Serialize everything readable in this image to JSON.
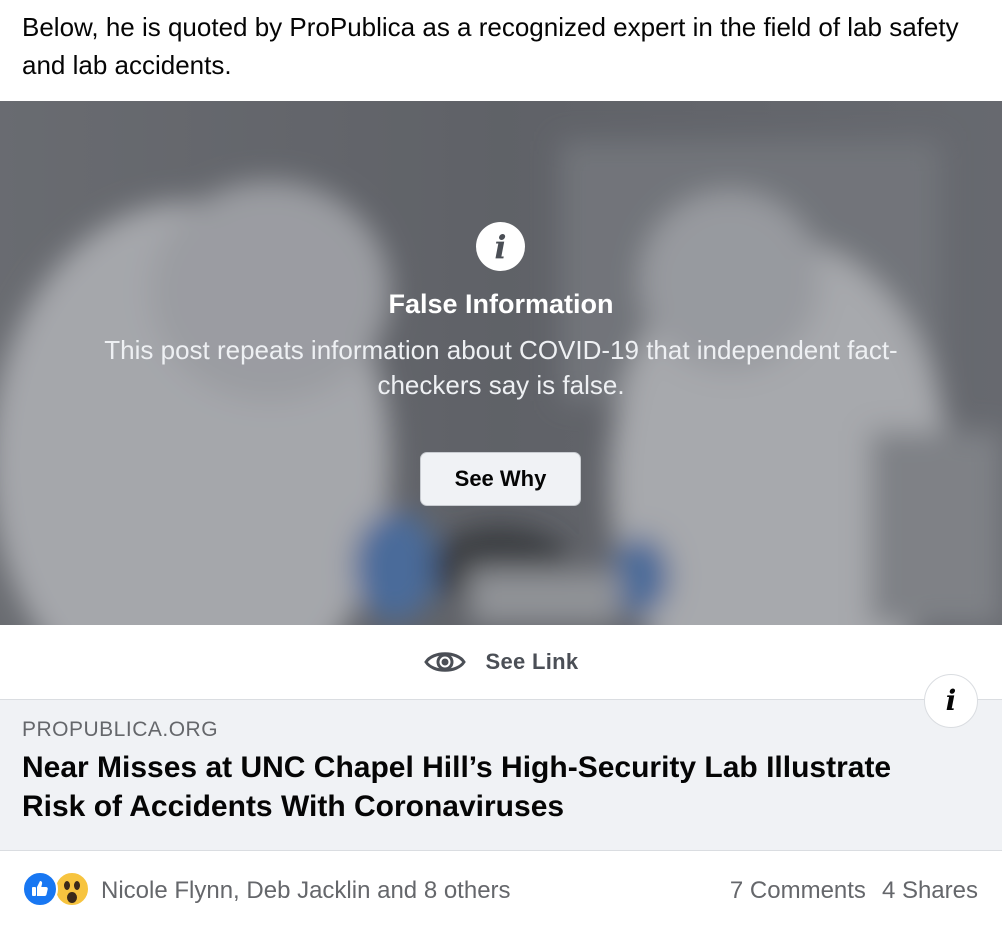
{
  "post": {
    "text": "Below, he is quoted by ProPublica as a recognized expert in the field of lab safety and lab accidents."
  },
  "warning": {
    "icon": "info-icon",
    "title": "False Information",
    "description": "This post repeats information about COVID-19 that independent fact-checkers say is false.",
    "button_label": "See Why"
  },
  "see_link": {
    "icon": "eye-icon",
    "label": "See Link"
  },
  "link_card": {
    "domain": "PROPUBLICA.ORG",
    "headline": "Near Misses at UNC Chapel Hill’s High-Security Lab Illustrate Risk of Accidents With Coronaviruses",
    "info_icon": "info-icon"
  },
  "footer": {
    "reaction_icons": [
      "like-icon",
      "wow-icon"
    ],
    "reaction_names": "Nicole Flynn, Deb Jacklin and 8 others",
    "comments": "7 Comments",
    "shares": "4 Shares"
  },
  "colors": {
    "like_blue": "#1877f2",
    "wow_yellow": "#f7c43f",
    "card_bg": "#f0f2f5",
    "secondary_text": "#65676b"
  }
}
